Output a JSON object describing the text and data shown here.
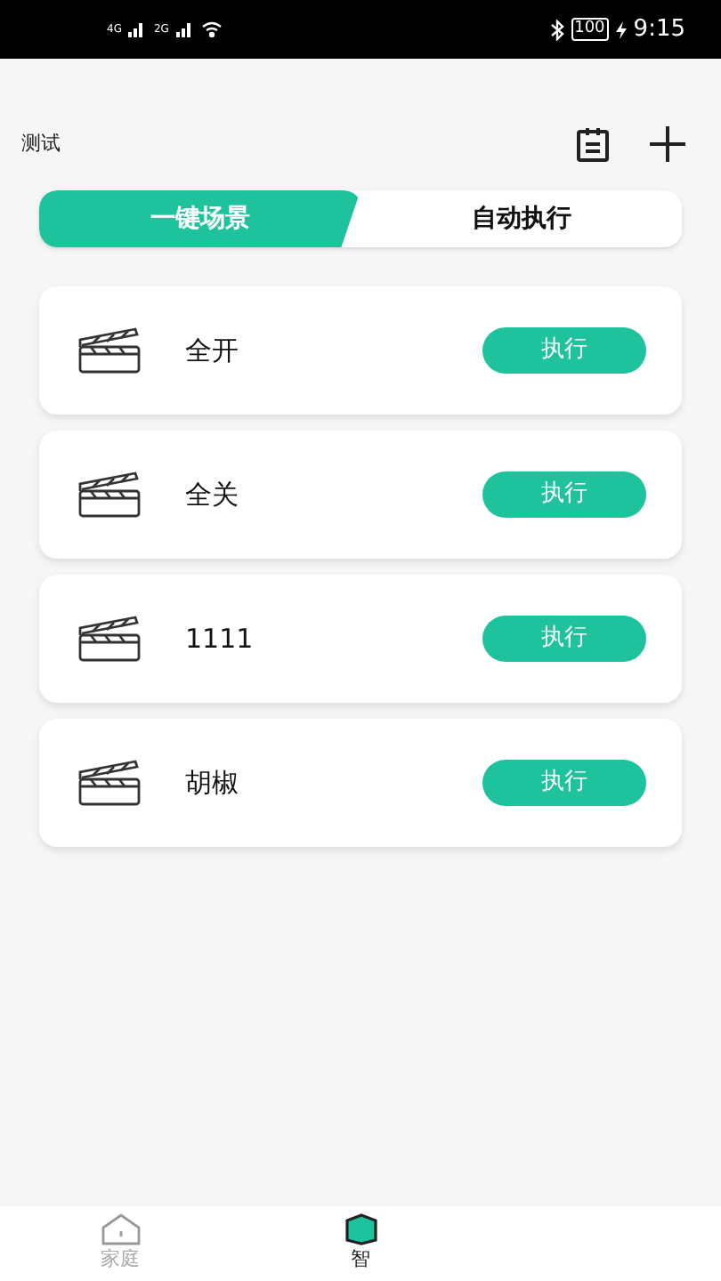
{
  "status_bar": {
    "signal_1": "4G",
    "signal_2": "2G",
    "battery": "100",
    "time": "9:15"
  },
  "header": {
    "title": "测试"
  },
  "tabs": [
    {
      "label": "一键场景",
      "selected": true
    },
    {
      "label": "自动执行",
      "selected": false
    }
  ],
  "scenes": [
    {
      "name": "全开",
      "action": "执行"
    },
    {
      "name": "全关",
      "action": "执行"
    },
    {
      "name": "1111",
      "action": "执行"
    },
    {
      "name": "胡椒",
      "action": "执行"
    }
  ],
  "bottom_nav": [
    {
      "label": "家庭",
      "selected": false
    },
    {
      "label": "智",
      "selected": true
    }
  ]
}
